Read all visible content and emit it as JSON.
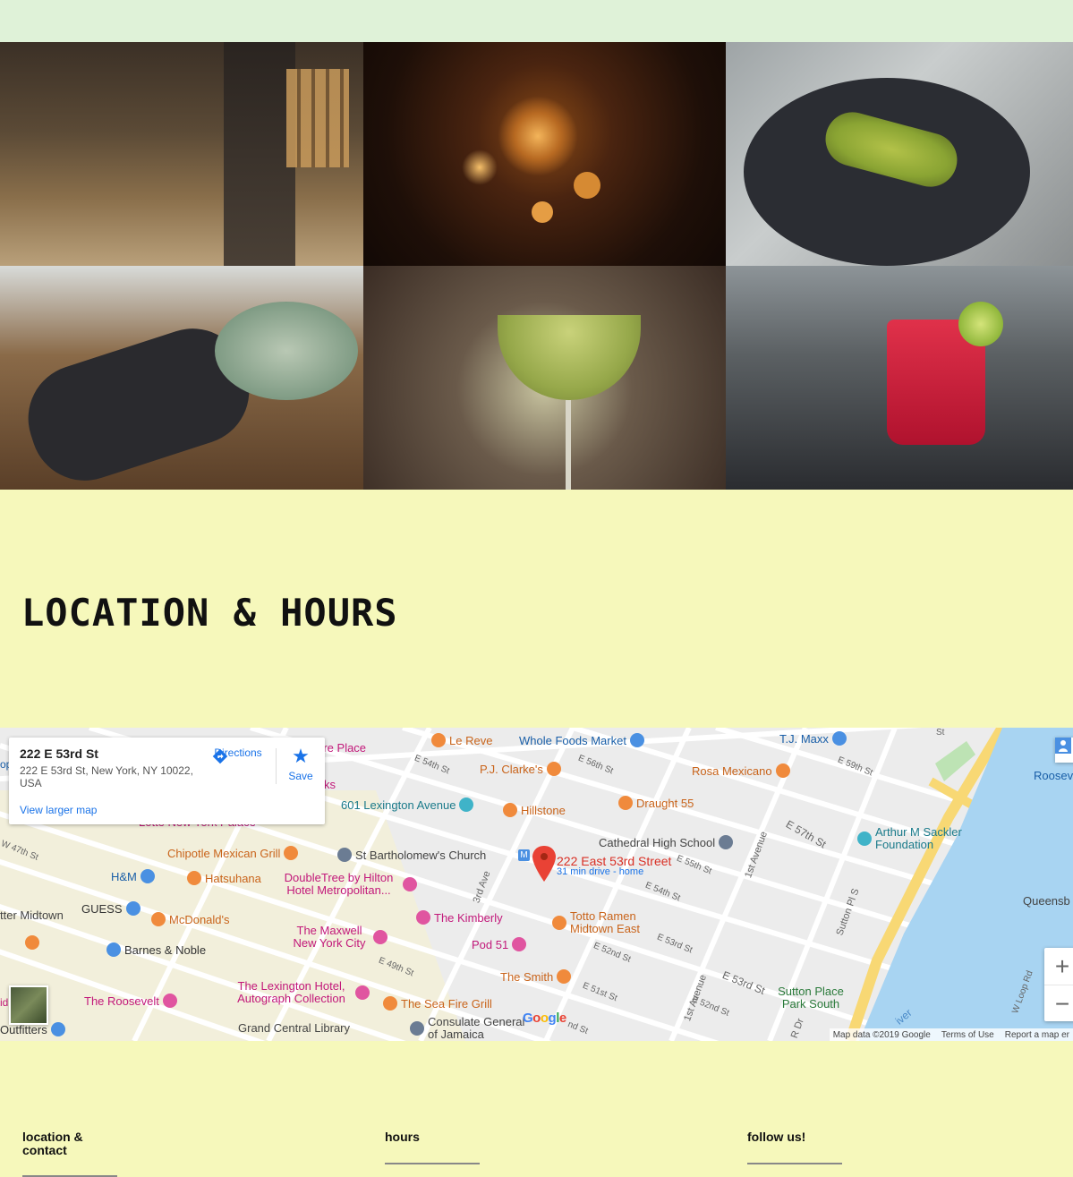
{
  "gallery": [
    {
      "name": "photo-interior",
      "alt": "restaurant interior"
    },
    {
      "name": "photo-lanterns",
      "alt": "lanterns"
    },
    {
      "name": "photo-sushi-plate",
      "alt": "sushi plate"
    },
    {
      "name": "photo-sushi-bowl",
      "alt": "sushi and bowl"
    },
    {
      "name": "photo-cocktail",
      "alt": "green cocktail"
    },
    {
      "name": "photo-red-drink",
      "alt": "red drink"
    }
  ],
  "section": {
    "title": "LOCATION & HOURS"
  },
  "map": {
    "card": {
      "name": "222 E 53rd St",
      "address": "222 E 53rd St, New York, NY 10022, USA",
      "directions": "Directions",
      "save": "Save",
      "larger": "View larger map"
    },
    "pin": {
      "label": "222 East 53rd Street",
      "sub": "31 min drive - home"
    },
    "places": {
      "berkshire": "Berkshire Place",
      "lereve": "Le Reve",
      "wholefoods": "Whole Foods Market",
      "tjmaxx": "T.J. Maxx",
      "roosev": "Roosev",
      "pjclarkes": "P.J. Clarke's",
      "rosa": "Rosa Mexicano",
      "ks": "ks",
      "lotte": "Lotte New York Palace",
      "lex601": "601 Lexington Avenue",
      "hillstone": "Hillstone",
      "draught": "Draught 55",
      "cathedral": "Cathedral High School",
      "sackler": "Arthur M Sackler Foundation",
      "chipotle": "Chipotle Mexican Grill",
      "bartholomew": "St Bartholomew's Church",
      "hm": "H&M",
      "hatsuhana": "Hatsuhana",
      "doubletree": "DoubleTree by Hilton Hotel Metropolitan...",
      "queensb": "Queensb",
      "midtown": "tter Midtown",
      "guess": "GUESS",
      "mcdonalds": "McDonald's",
      "kimberly": "The Kimberly",
      "totto": "Totto Ramen Midtown East",
      "maxwell": "The Maxwell New York City",
      "pod51": "Pod 51",
      "barnes": "Barnes & Noble",
      "smith": "The Smith",
      "sutton": "Sutton Place Park South",
      "lexhotel": "The Lexington Hotel, Autograph Collection",
      "roosevelt": "The Roosevelt",
      "seafire": "The Sea Fire Grill",
      "consulate": "Consulate General of Jamaica",
      "grandcentral": "Grand Central Library",
      "outfitters": "Outfitters"
    },
    "streets": {
      "e54": "E 54th St",
      "e56": "E 56th St",
      "e59": "E 59th St",
      "e57": "E 57th St",
      "e55": "E 55th St",
      "e54b": "E 54th St",
      "w47": "W 47th St",
      "third": "3rd Ave",
      "first": "1st Avenue",
      "firstb": "1st Avenue",
      "sutton": "Sutton Pl S",
      "e53a": "E 53rd St",
      "e53b": "E 53rd St",
      "e52": "E 52nd St",
      "e52b": "E 52nd St",
      "e51": "E 51st St",
      "e49": "E 49th St",
      "wloop": "W Loop Rd",
      "rdr": "R Dr",
      "river": "iver",
      "st": "St",
      "nd": "nd St",
      "op": "op",
      "id": "id"
    },
    "google": "Google",
    "attribution": {
      "data": "Map data ©2019 Google",
      "terms": "Terms of Use",
      "report": "Report a map er"
    },
    "zoom": {
      "in": "+",
      "out": "−"
    },
    "colors": {
      "water": "#a8d4f2",
      "road": "#ffffff",
      "highway": "#f8d874",
      "block": "#f3efd9"
    }
  },
  "footer": {
    "location": "location & contact",
    "hours": "hours",
    "follow": "follow us!"
  }
}
